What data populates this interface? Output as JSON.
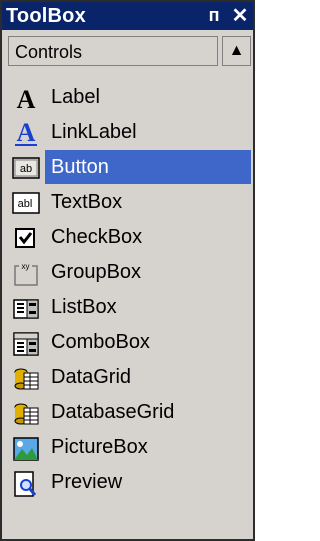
{
  "window": {
    "title": "ToolBox",
    "pin_glyph": "ᴨ",
    "close_glyph": "✕"
  },
  "section": {
    "label": "Controls",
    "scroll_glyph": "▲"
  },
  "items": [
    {
      "label": "Label",
      "icon": "label-icon",
      "selected": false
    },
    {
      "label": "LinkLabel",
      "icon": "linklabel-icon",
      "selected": false
    },
    {
      "label": "Button",
      "icon": "button-icon",
      "selected": true
    },
    {
      "label": "TextBox",
      "icon": "textbox-icon",
      "selected": false
    },
    {
      "label": "CheckBox",
      "icon": "checkbox-icon",
      "selected": false
    },
    {
      "label": "GroupBox",
      "icon": "groupbox-icon",
      "selected": false
    },
    {
      "label": "ListBox",
      "icon": "listbox-icon",
      "selected": false
    },
    {
      "label": "ComboBox",
      "icon": "combobox-icon",
      "selected": false
    },
    {
      "label": "DataGrid",
      "icon": "datagrid-icon",
      "selected": false
    },
    {
      "label": "DatabaseGrid",
      "icon": "databasegrid-icon",
      "selected": false
    },
    {
      "label": "PictureBox",
      "icon": "picturebox-icon",
      "selected": false
    },
    {
      "label": "Preview",
      "icon": "preview-icon",
      "selected": false
    }
  ],
  "colors": {
    "titlebar": "#0a246a",
    "selection": "#3f67c9",
    "panel": "#d6d3ce"
  }
}
